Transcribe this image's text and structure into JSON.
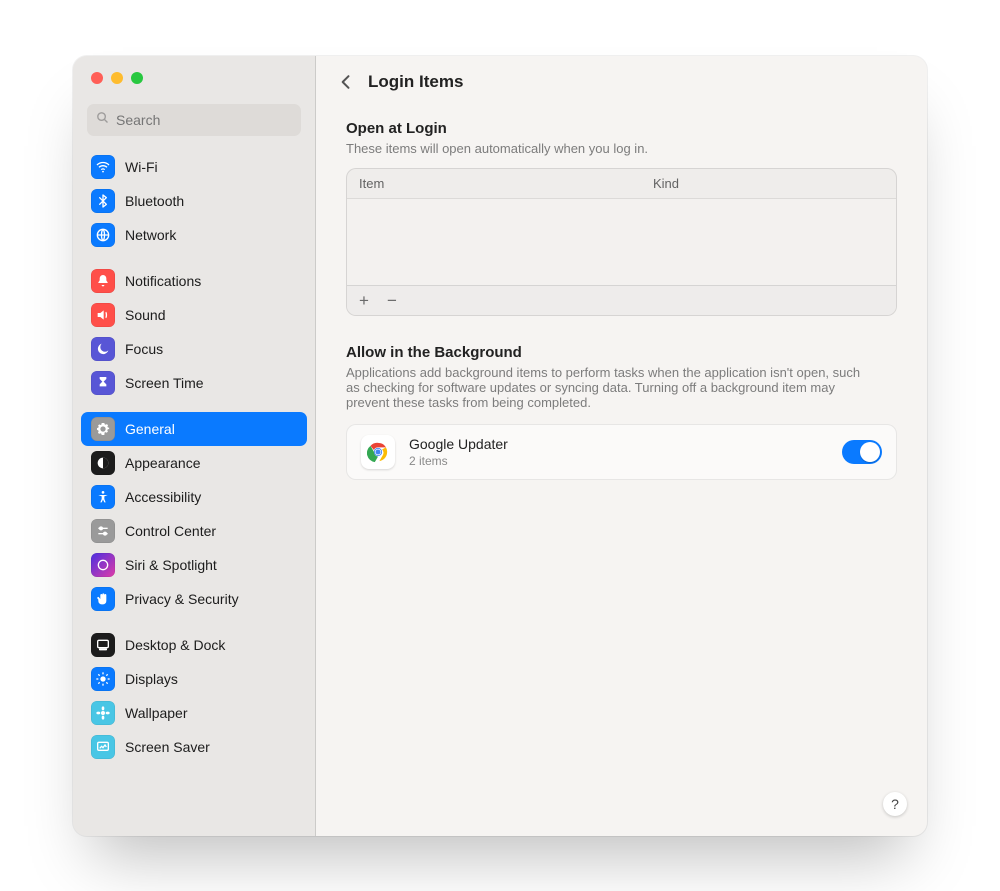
{
  "search": {
    "placeholder": "Search"
  },
  "sidebar": {
    "groups": [
      {
        "items": [
          {
            "id": "wifi",
            "label": "Wi-Fi",
            "bg": "#0a7aff"
          },
          {
            "id": "bluetooth",
            "label": "Bluetooth",
            "bg": "#0a7aff"
          },
          {
            "id": "network",
            "label": "Network",
            "bg": "#0a7aff"
          }
        ]
      },
      {
        "items": [
          {
            "id": "notifications",
            "label": "Notifications",
            "bg": "#ff4f49"
          },
          {
            "id": "sound",
            "label": "Sound",
            "bg": "#ff4f49"
          },
          {
            "id": "focus",
            "label": "Focus",
            "bg": "#5856d6"
          },
          {
            "id": "screentime",
            "label": "Screen Time",
            "bg": "#5856d6"
          }
        ]
      },
      {
        "items": [
          {
            "id": "general",
            "label": "General",
            "bg": "#9a9a9a",
            "selected": true
          },
          {
            "id": "appearance",
            "label": "Appearance",
            "bg": "#1c1c1c"
          },
          {
            "id": "accessibility",
            "label": "Accessibility",
            "bg": "#0a7aff"
          },
          {
            "id": "controlcenter",
            "label": "Control Center",
            "bg": "#9a9a9a"
          },
          {
            "id": "siri",
            "label": "Siri & Spotlight",
            "bg": "#1c1c1c"
          },
          {
            "id": "privacy",
            "label": "Privacy & Security",
            "bg": "#0a7aff"
          }
        ]
      },
      {
        "items": [
          {
            "id": "desktop",
            "label": "Desktop & Dock",
            "bg": "#1c1c1c"
          },
          {
            "id": "displays",
            "label": "Displays",
            "bg": "#0a7aff"
          },
          {
            "id": "wallpaper",
            "label": "Wallpaper",
            "bg": "#49c6e5"
          },
          {
            "id": "screensaver",
            "label": "Screen Saver",
            "bg": "#49c6e5"
          }
        ]
      }
    ]
  },
  "header": {
    "title": "Login Items"
  },
  "open_at_login": {
    "title": "Open at Login",
    "subtitle": "These items will open automatically when you log in.",
    "columns": {
      "item": "Item",
      "kind": "Kind"
    },
    "add": "+",
    "remove": "−"
  },
  "allow_background": {
    "title": "Allow in the Background",
    "subtitle": "Applications add background items to perform tasks when the application isn't open, such as checking for software updates or syncing data. Turning off a background item may prevent these tasks from being completed.",
    "items": [
      {
        "name": "Google Updater",
        "detail": "2 items",
        "enabled": true
      }
    ]
  },
  "help": {
    "label": "?"
  }
}
